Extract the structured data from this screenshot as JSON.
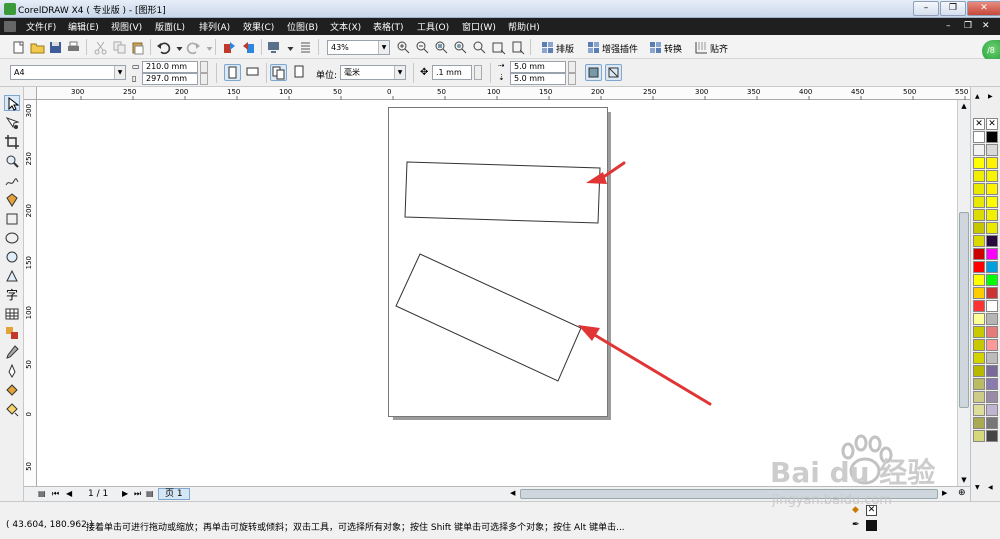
{
  "window": {
    "title": "CorelDRAW X4 ( 专业版 ) - [图形1]",
    "minimize_label": "–",
    "restore_label": "❐",
    "close_label": "✕"
  },
  "menu": {
    "items": [
      {
        "label": "文件(F)"
      },
      {
        "label": "编辑(E)"
      },
      {
        "label": "视图(V)"
      },
      {
        "label": "版面(L)"
      },
      {
        "label": "排列(A)"
      },
      {
        "label": "效果(C)"
      },
      {
        "label": "位图(B)"
      },
      {
        "label": "文本(X)"
      },
      {
        "label": "表格(T)"
      },
      {
        "label": "工具(O)"
      },
      {
        "label": "窗口(W)"
      },
      {
        "label": "帮助(H)"
      }
    ]
  },
  "standard_toolbar": {
    "zoom_value": "43%",
    "plugins": [
      {
        "label": "排版",
        "icon": "layout-grid-icon"
      },
      {
        "label": "增强插件",
        "icon": "plugin-grid-icon"
      },
      {
        "label": "转换",
        "icon": "convert-grid-icon"
      },
      {
        "label": "贴齐",
        "icon": "snap-grid-icon"
      }
    ],
    "badge_text": "/8"
  },
  "property_bar": {
    "paper_size": "A4",
    "width": "210.0 mm",
    "height": "297.0 mm",
    "units_label": "单位:",
    "units_value": "毫米",
    "nudge": ".1 mm",
    "dup_x": "5.0 mm",
    "dup_y": "5.0 mm"
  },
  "rulers": {
    "horizontal_ticks": [
      "300",
      "250",
      "200",
      "150",
      "100",
      "50",
      "0",
      "50",
      "100",
      "150",
      "200",
      "250",
      "300",
      "350",
      "400",
      "450",
      "500",
      "550"
    ],
    "vertical_ticks": [
      "300",
      "250",
      "200",
      "150",
      "100",
      "50",
      "0",
      "50"
    ]
  },
  "page_nav": {
    "page_count": "1 / 1",
    "page_tab": "页 1"
  },
  "status": {
    "coords": "( 43.604, 180.962 )",
    "hint": "接着单击可进行拖动或缩放；再单击可旋转或倾斜；双击工具，可选择所有对象；按住 Shift 键单击可选择多个对象；按住 Alt 键单击..."
  },
  "palette": {
    "colors": [
      "#ffffff",
      "#000000",
      "#f2f2f2",
      "#d9d9d9",
      "#ffff00",
      "#fff200",
      "#f2ee00",
      "#f5f500",
      "#e9e900",
      "#fff300",
      "#e8e800",
      "#fdfd00",
      "#dcdc00",
      "#f0f000",
      "#c7c700",
      "#eaea00",
      "#d9d900",
      "#2a0a3e",
      "#cc0000",
      "#ff00ff",
      "#ff0000",
      "#00a0e0",
      "#ffff00",
      "#00ff00",
      "#ffcc00",
      "#cc3333",
      "#ff3333",
      "#ffffff",
      "#ffff99",
      "#b5b5b5",
      "#c9c900",
      "#e87a7a",
      "#c8c800",
      "#ff9999",
      "#d3d300",
      "#bbbbbb",
      "#b8b800",
      "#7a6a9a",
      "#bbbb66",
      "#8a7ab0",
      "#cccc88",
      "#9a8aa6",
      "#dede9c",
      "#c0b5d0",
      "#aaaa55",
      "#777777",
      "#d6d67a",
      "#444444"
    ]
  },
  "watermark": {
    "brand": "Bai du 经验",
    "url": "jingyan.baidu.com"
  }
}
